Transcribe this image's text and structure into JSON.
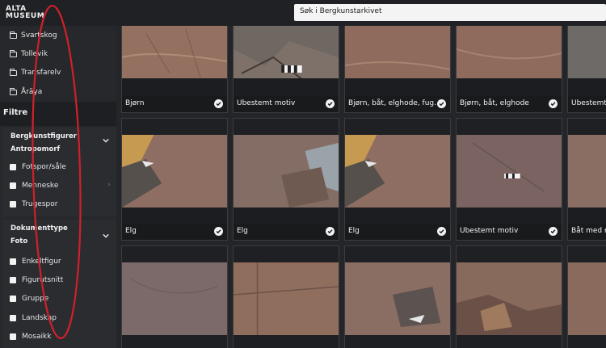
{
  "brand": {
    "line1": "ALTA",
    "line2": "MUSEUM"
  },
  "search": {
    "placeholder": "Søk i Bergkunstarkivet"
  },
  "sidebar": {
    "locations": [
      "Svartskog",
      "Tollevik",
      "Transfarelv",
      "Åräya"
    ],
    "filter_title": "Filtre",
    "groups": [
      {
        "title_line1": "Bergkunstfigurer",
        "title_line2": "Antropomorf",
        "options": [
          "Fotspor/såle",
          "Menneske",
          "Trugespor"
        ]
      },
      {
        "title_line1": "Dokumenttype",
        "title_line2": "Foto",
        "options": [
          "Enkeltfigur",
          "Figurutsnitt",
          "Gruppe",
          "Landskap",
          "Mosaikk"
        ]
      }
    ]
  },
  "grid": {
    "row1": [
      "Bjørn",
      "Ubestemt motiv",
      "Bjørn, båt, elghode, fug…",
      "Bjørn, båt, elghode",
      "Ubestemt m"
    ],
    "row2": [
      "Elg",
      "Elg",
      "Elg",
      "Ubestemt motiv",
      "Båt med m"
    ],
    "row3": [
      "",
      "",
      "",
      "",
      ""
    ]
  },
  "colors": {
    "annotation": "#d0202a",
    "background": "#232528",
    "caption_bg": "#191a1c"
  }
}
